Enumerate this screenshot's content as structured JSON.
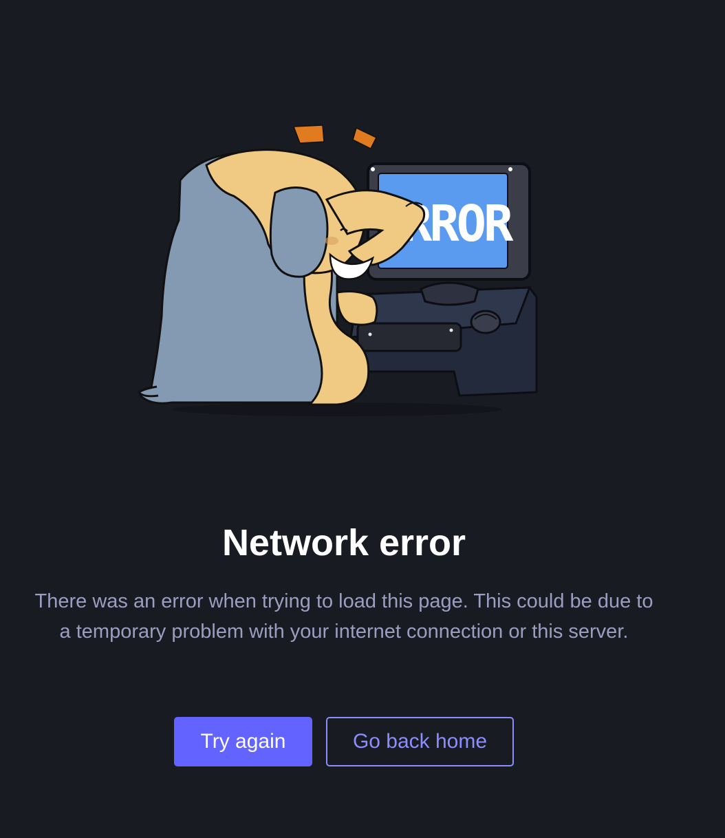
{
  "illustration": {
    "screen_text": "ERROR"
  },
  "error": {
    "title": "Network error",
    "message": "There was an error when trying to load this page. This could be due to a temporary problem with your internet connection or this server."
  },
  "actions": {
    "try_again_label": "Try again",
    "go_home_label": "Go back home"
  },
  "colors": {
    "background": "#191b22",
    "accent": "#6364ff",
    "secondary_text": "#9d9dc2",
    "link": "#8c8dff"
  }
}
